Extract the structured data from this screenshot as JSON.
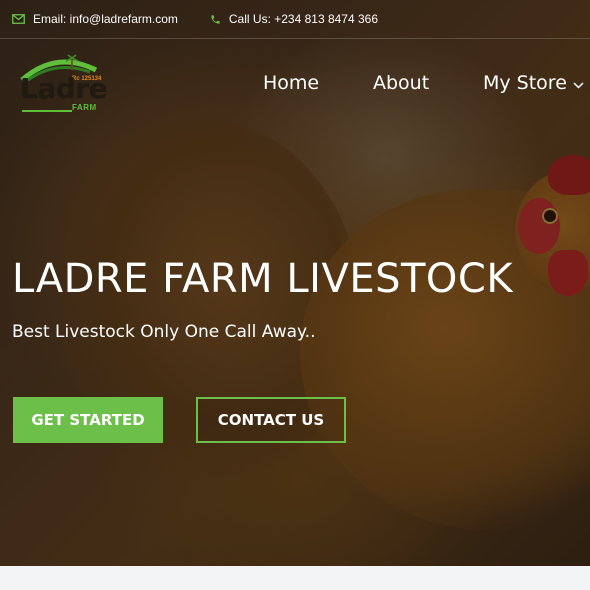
{
  "topbar": {
    "email": "Email: info@ladrefarm.com",
    "phone": "Call Us: +234 813 8474 366",
    "email_icon": "envelope-icon",
    "phone_icon": "phone-icon"
  },
  "logo": {
    "word": "Ladre",
    "sub": "FARM",
    "rc": "Rc 125134"
  },
  "nav": {
    "items": [
      {
        "label": "Home"
      },
      {
        "label": "About"
      },
      {
        "label": "My Store",
        "icon": "chevron-down-icon"
      }
    ]
  },
  "hero": {
    "title": "LADRE FARM LIVESTOCK",
    "subtitle": "Best Livestock Only One Call Away..",
    "primary_button": "GET STARTED",
    "secondary_button": "CONTACT US"
  },
  "colors": {
    "accent": "#6cc04a",
    "text": "#ffffff"
  }
}
